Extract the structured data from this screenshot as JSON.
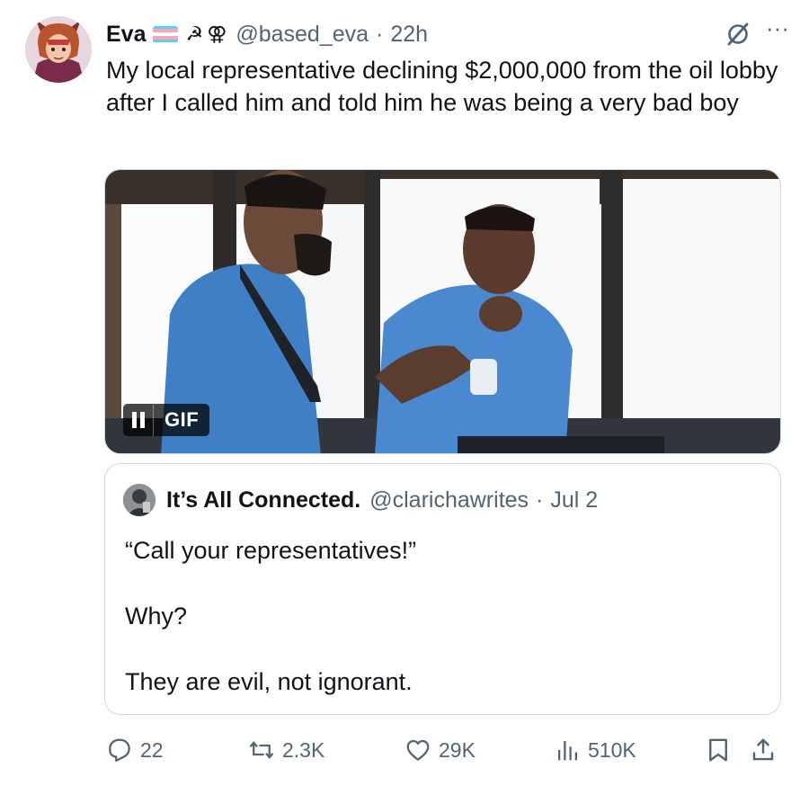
{
  "tweet": {
    "display_name": "Eva",
    "handle": "@based_eva",
    "separator": "·",
    "time": "22h",
    "header_icons": [
      "trans-flag-icon",
      "hammer-sickle-icon",
      "feminist-symbol-icon"
    ],
    "hammer_sickle_glyph": "☭",
    "feminist_glyph": "⚢",
    "more_label": "···",
    "text": "My local representative declining $2,000,000 from the oil lobby after I called him and told him he was being a very bad boy"
  },
  "media": {
    "badge_label": "GIF",
    "state": "playing",
    "accent_shirt": "#3f7fc6"
  },
  "quote": {
    "display_name": "It’s All Connected.",
    "handle": "@clarichawrites",
    "separator": "·",
    "date": "Jul 2",
    "lines": [
      "“Call your representatives!”",
      "Why?",
      "They are evil, not ignorant."
    ]
  },
  "actions": {
    "replies": "22",
    "reposts": "2.3K",
    "likes": "29K",
    "views": "510K"
  },
  "colors": {
    "text": "#0f1419",
    "secondary": "#536471",
    "border": "#cfd9de",
    "trans_blue": "#5bcefa",
    "trans_pink": "#f5a9b8"
  }
}
